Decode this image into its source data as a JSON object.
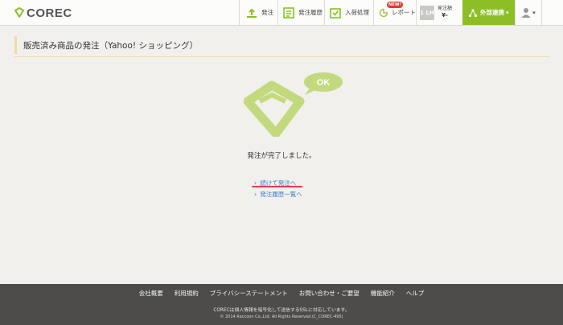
{
  "header": {
    "logo_text": "COREC",
    "nav": {
      "order": "発注",
      "history": "発注履歴",
      "receive": "入荷処理",
      "report": "レポート",
      "new_badge": "NEW!"
    },
    "order_count": {
      "number": "1 LH",
      "label": "発注額",
      "value": "¥-"
    },
    "external": "外部連携"
  },
  "page": {
    "title": "販売済み商品の発注（Yahoo! ショッピング）",
    "ok_bubble": "OK",
    "message": "発注が完了しました。",
    "link_continue": "続けて発注へ",
    "link_history": "発注履歴一覧へ"
  },
  "footer": {
    "links": [
      "会社概要",
      "利用規約",
      "プライバシーステートメント",
      "お問い合わせ・ご要望",
      "機能紹介",
      "ヘルプ"
    ],
    "note": "CORECは個人情報を暗号化して送信するSSLに対応しています。",
    "copyright": "© 2014 Raccoon Co.,Ltd. All Rights Reserved.(C_COREC-495)"
  },
  "colors": {
    "accent_green": "#8cbf26",
    "link_blue": "#3a7ec9",
    "underline_red": "#e8384a"
  }
}
